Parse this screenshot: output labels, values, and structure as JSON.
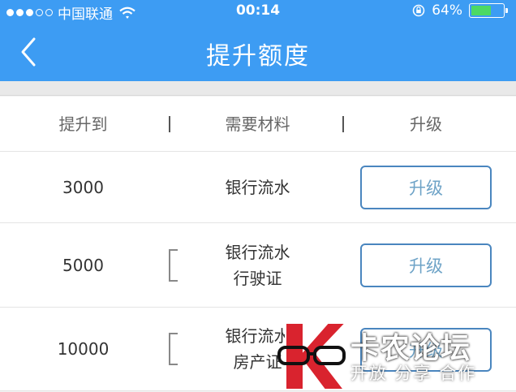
{
  "status_bar": {
    "carrier": "中国联通",
    "time": "00:14",
    "battery_text": "64%",
    "battery_level": 0.64,
    "signal_bars_filled": 3,
    "signal_bars_total": 5
  },
  "nav": {
    "back_icon": "chevron-left-icon",
    "title": "提升额度"
  },
  "table": {
    "headers": [
      "提升到",
      "需要材料",
      "升级"
    ],
    "rows": [
      {
        "amount": "3000",
        "materials": [
          "银行流水"
        ],
        "button": "升级"
      },
      {
        "amount": "5000",
        "materials": [
          "银行流水",
          "行驶证"
        ],
        "button": "升级"
      },
      {
        "amount": "10000",
        "materials": [
          "银行流水",
          "房产证"
        ],
        "button": "升级"
      }
    ]
  },
  "watermark": {
    "title": "卡农论坛",
    "subtitle": "开放 分享 合作"
  },
  "colors": {
    "header_bg": "#3d9cf3",
    "button_border": "#4a86bf",
    "button_text": "#6ea3c7",
    "battery_fill": "#4cd964",
    "logo_red": "#d9232e"
  }
}
